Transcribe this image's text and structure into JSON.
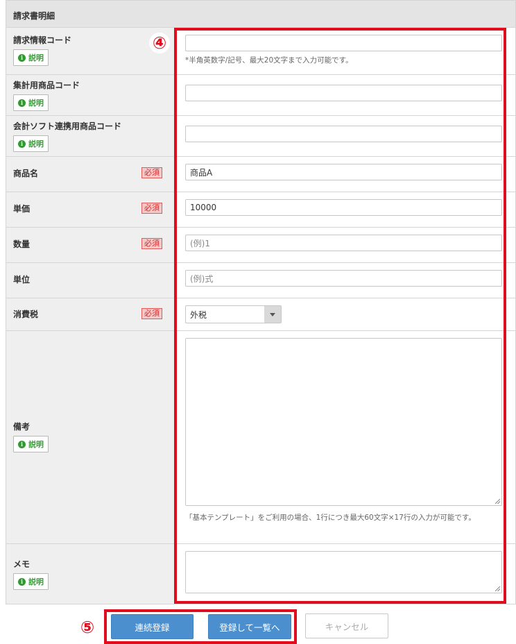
{
  "section": {
    "title": "請求書明細"
  },
  "help_label": "説明",
  "info_glyph": "i",
  "required_label": "必須",
  "fields": {
    "invoice_code": {
      "label": "請求情報コード",
      "value": "",
      "hint": "*半角英数字/記号、最大20文字まで入力可能です。"
    },
    "aggregate_code": {
      "label": "集計用商品コード",
      "value": ""
    },
    "accounting_code": {
      "label": "会計ソフト連携用商品コード",
      "value": ""
    },
    "product_name": {
      "label": "商品名",
      "value": "商品A"
    },
    "unit_price": {
      "label": "単価",
      "value": "10000"
    },
    "quantity": {
      "label": "数量",
      "placeholder": "(例)1"
    },
    "unit": {
      "label": "単位",
      "placeholder": "(例)式"
    },
    "tax": {
      "label": "消費税",
      "selected": "外税"
    },
    "notes": {
      "label": "備考",
      "value": "",
      "hint": "「基本テンプレート」をご利用の場合、1行につき最大60文字×17行の入力が可能です。"
    },
    "memo": {
      "label": "メモ",
      "value": ""
    }
  },
  "annotations": {
    "marker_4": "④",
    "marker_5": "⑤"
  },
  "buttons": {
    "continuous_register": "連続登録",
    "register_to_list": "登録して一覧へ",
    "cancel": "キャンセル"
  },
  "colors": {
    "highlight_red": "#e00d1f",
    "primary_button": "#4b8fcf",
    "help_green": "#3c9b3c",
    "required_badge_bg": "#f6c9c9"
  },
  "icons": {
    "help": "info-circle-icon",
    "select": "chevron-down-icon"
  }
}
